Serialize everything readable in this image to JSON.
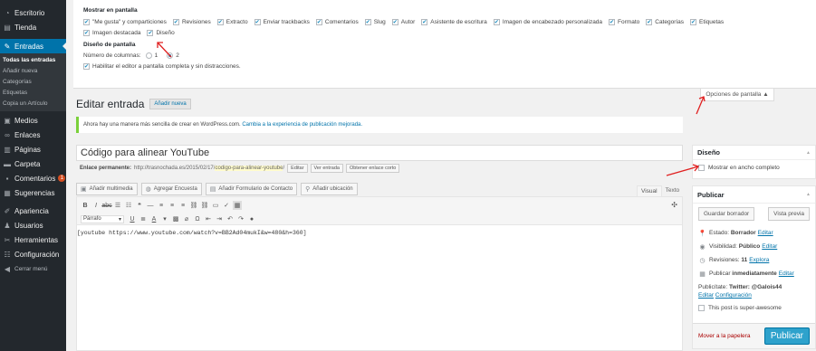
{
  "menu": {
    "items": [
      {
        "icon": "speedometer-icon",
        "label": "Escritorio"
      },
      {
        "icon": "store-icon",
        "label": "Tienda"
      },
      {
        "icon": "pin-icon",
        "label": "Entradas"
      },
      {
        "icon": "media-icon",
        "label": "Medios"
      },
      {
        "icon": "link-icon",
        "label": "Enlaces"
      },
      {
        "icon": "pages-icon",
        "label": "Páginas"
      },
      {
        "icon": "folder-icon",
        "label": "Carpeta"
      },
      {
        "icon": "comments-icon",
        "label": "Comentarios",
        "badge": "1"
      },
      {
        "icon": "feedback-icon",
        "label": "Sugerencias"
      },
      {
        "icon": "brush-icon",
        "label": "Apariencia"
      },
      {
        "icon": "users-icon",
        "label": "Usuarios"
      },
      {
        "icon": "wrench-icon",
        "label": "Herramientas"
      },
      {
        "icon": "settings-icon",
        "label": "Configuración"
      },
      {
        "icon": "collapse-icon",
        "label": "Cerrar menú"
      }
    ],
    "submenu": [
      "Todas las entradas",
      "Añadir nueva",
      "Categorías",
      "Etiquetas",
      "Copia un Artículo"
    ]
  },
  "screen_options": {
    "title": "Mostrar en pantalla",
    "boxes_row1": [
      "\"Me gusta\" y comparticiones",
      "Revisiones",
      "Extracto",
      "Enviar trackbacks",
      "Comentarios",
      "Slug",
      "Autor",
      "Asistente de escritura",
      "Imagen de encabezado personalizada",
      "Formato",
      "Categorías",
      "Etiquetas"
    ],
    "boxes_row2": [
      "Imagen destacada",
      "Diseño"
    ],
    "layout_title": "Diseño de pantalla",
    "columns_label": "Número de columnas:",
    "col1": "1",
    "col2": "2",
    "fullscreen_label": "Habilitar el editor a pantalla completa y sin distracciones.",
    "tab_label": "Opciones de pantalla ▲"
  },
  "page": {
    "title": "Editar entrada",
    "add_new": "Añadir nueva",
    "notice": "Ahora hay una manera más sencilla de crear en WordPress.com.",
    "notice_link": "Cambia a la experiencia de publicación mejorada.",
    "post_title": "Código para alinear YouTube",
    "permalink_label": "Enlace permanente:",
    "permalink_base": "http://trasnochada.es/2015/02/17/",
    "permalink_slug": "codigo-para-alinear-youtube",
    "permalink_end": "/",
    "edit_btn": "Editar",
    "view_btn": "Ver entrada",
    "shortlink_btn": "Obtener enlace corto"
  },
  "media_buttons": [
    {
      "icon": "media-add-icon",
      "label": "Añadir multimedia"
    },
    {
      "icon": "poll-icon",
      "label": "Agregar Encuesta"
    },
    {
      "icon": "form-icon",
      "label": "Añadir Formulario de Contacto"
    },
    {
      "icon": "location-icon",
      "label": "Añadir ubicación"
    }
  ],
  "editor": {
    "tab_visual": "Visual",
    "tab_text": "Texto",
    "format_select": "Párrafo",
    "content": "[youtube https://www.youtube.com/watch?v=BB2Ad04mukI&w=480&h=360]"
  },
  "layout_box": {
    "title": "Diseño",
    "option": "Mostrar en ancho completo"
  },
  "publish_box": {
    "title": "Publicar",
    "save_draft": "Guardar borrador",
    "preview": "Vista previa",
    "status_label": "Estado:",
    "status_value": "Borrador",
    "visibility_label": "Visibilidad:",
    "visibility_value": "Público",
    "revisions_label": "Revisiones:",
    "revisions_value": "11",
    "revisions_link": "Explora",
    "publish_label": "Publicar",
    "publish_value": "inmediatamente",
    "edit": "Editar",
    "publicize_label": "Publicítate:",
    "publicize_value": "Twitter: @Galois44",
    "publicize_edit": "Editar",
    "publicize_config": "Configuración",
    "super_awesome": "This post is super-awesome",
    "trash": "Mover a la papelera",
    "publish_btn": "Publicar"
  },
  "colors": {
    "admin_bg": "#23282d",
    "accent": "#0073aa",
    "publish": "#2ea2cc",
    "annotation": "#e02020"
  }
}
